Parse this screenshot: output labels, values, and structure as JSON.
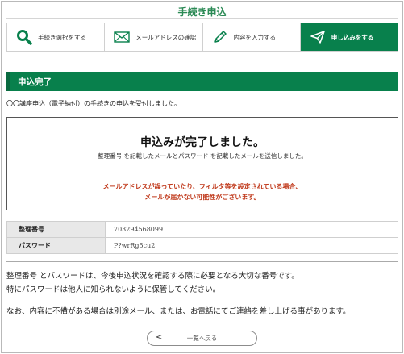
{
  "header": {
    "title": "手続き申込"
  },
  "steps": [
    {
      "label": "手続き選択をする",
      "icon": "search-icon"
    },
    {
      "label": "メールアドレスの確認",
      "icon": "envelope-icon"
    },
    {
      "label": "内容を入力する",
      "icon": "pencil-icon"
    },
    {
      "label": "申し込みをする",
      "icon": "send-icon",
      "active": true
    }
  ],
  "section": {
    "title": "申込完了"
  },
  "intro": "〇〇講座申込（電子納付）の手続きの申込を受付しました。",
  "complete": {
    "heading": "申込みが完了しました。",
    "sub": "整理番号 を記載したメールとパスワード を記載したメールを送信しました。",
    "warning_line1": "メールアドレスが誤っていたり、フィルタ等を設定されている場合、",
    "warning_line2": "メールが届かない可能性がございます。"
  },
  "info": {
    "ref_label": "整理番号",
    "ref_value": "703294568099",
    "pw_label": "パスワード",
    "pw_value": "P?wrRg5cu2"
  },
  "notes": {
    "line1": "整理番号 とパスワードは、今後申込状況を確認する際に必要となる大切な番号です。",
    "line2": "特にパスワードは他人に知られないように保管してください。",
    "line3": "なお、内容に不備がある場合は別途メール、または、お電話にてご連絡を差し上げる事があります。"
  },
  "back_button": {
    "chevron": "<",
    "label": "一覧へ戻る"
  },
  "colors": {
    "brand_green": "#08804c",
    "warning_red": "#c0391b"
  }
}
